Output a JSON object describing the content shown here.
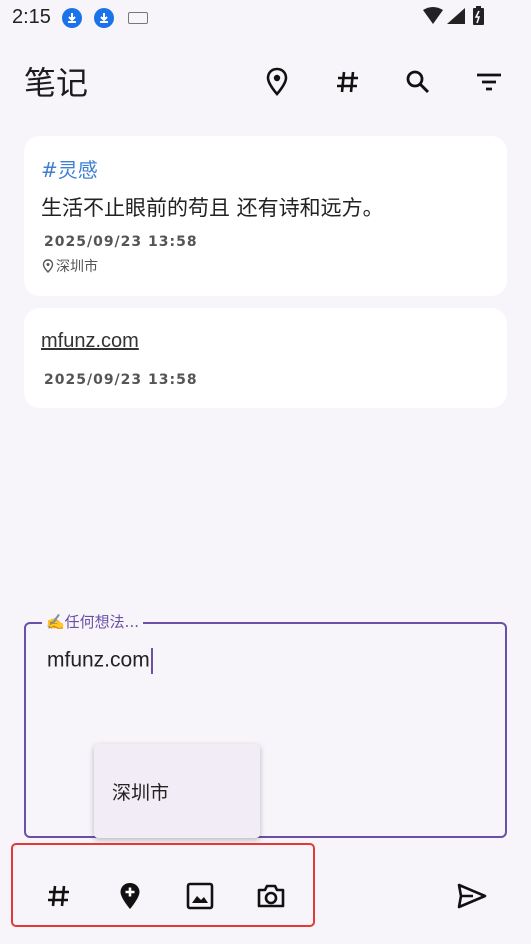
{
  "status_bar": {
    "time": "2:15"
  },
  "app_bar": {
    "title": "笔记",
    "actions": [
      "location-icon",
      "hashtag-icon",
      "search-icon",
      "filter-icon"
    ]
  },
  "notes": [
    {
      "tag": "#灵感",
      "text": "生活不止眼前的苟且 还有诗和远方。",
      "date": "2025/09/23 13:58",
      "location": "深圳市"
    },
    {
      "url": "mfunz.com",
      "date": "2025/09/23 13:58"
    }
  ],
  "composer": {
    "label": "✍️任何想法...",
    "value": "mfunz.com",
    "location_suggestion": "深圳市"
  },
  "toolbar": {
    "buttons": [
      "hashtag-icon",
      "add-location-icon",
      "image-icon",
      "camera-icon"
    ],
    "send": "send-icon"
  },
  "colors": {
    "accent": "#6a50a7",
    "tag": "#3f7fd0",
    "highlight": "#e53935",
    "background": "#f7f5f9"
  }
}
